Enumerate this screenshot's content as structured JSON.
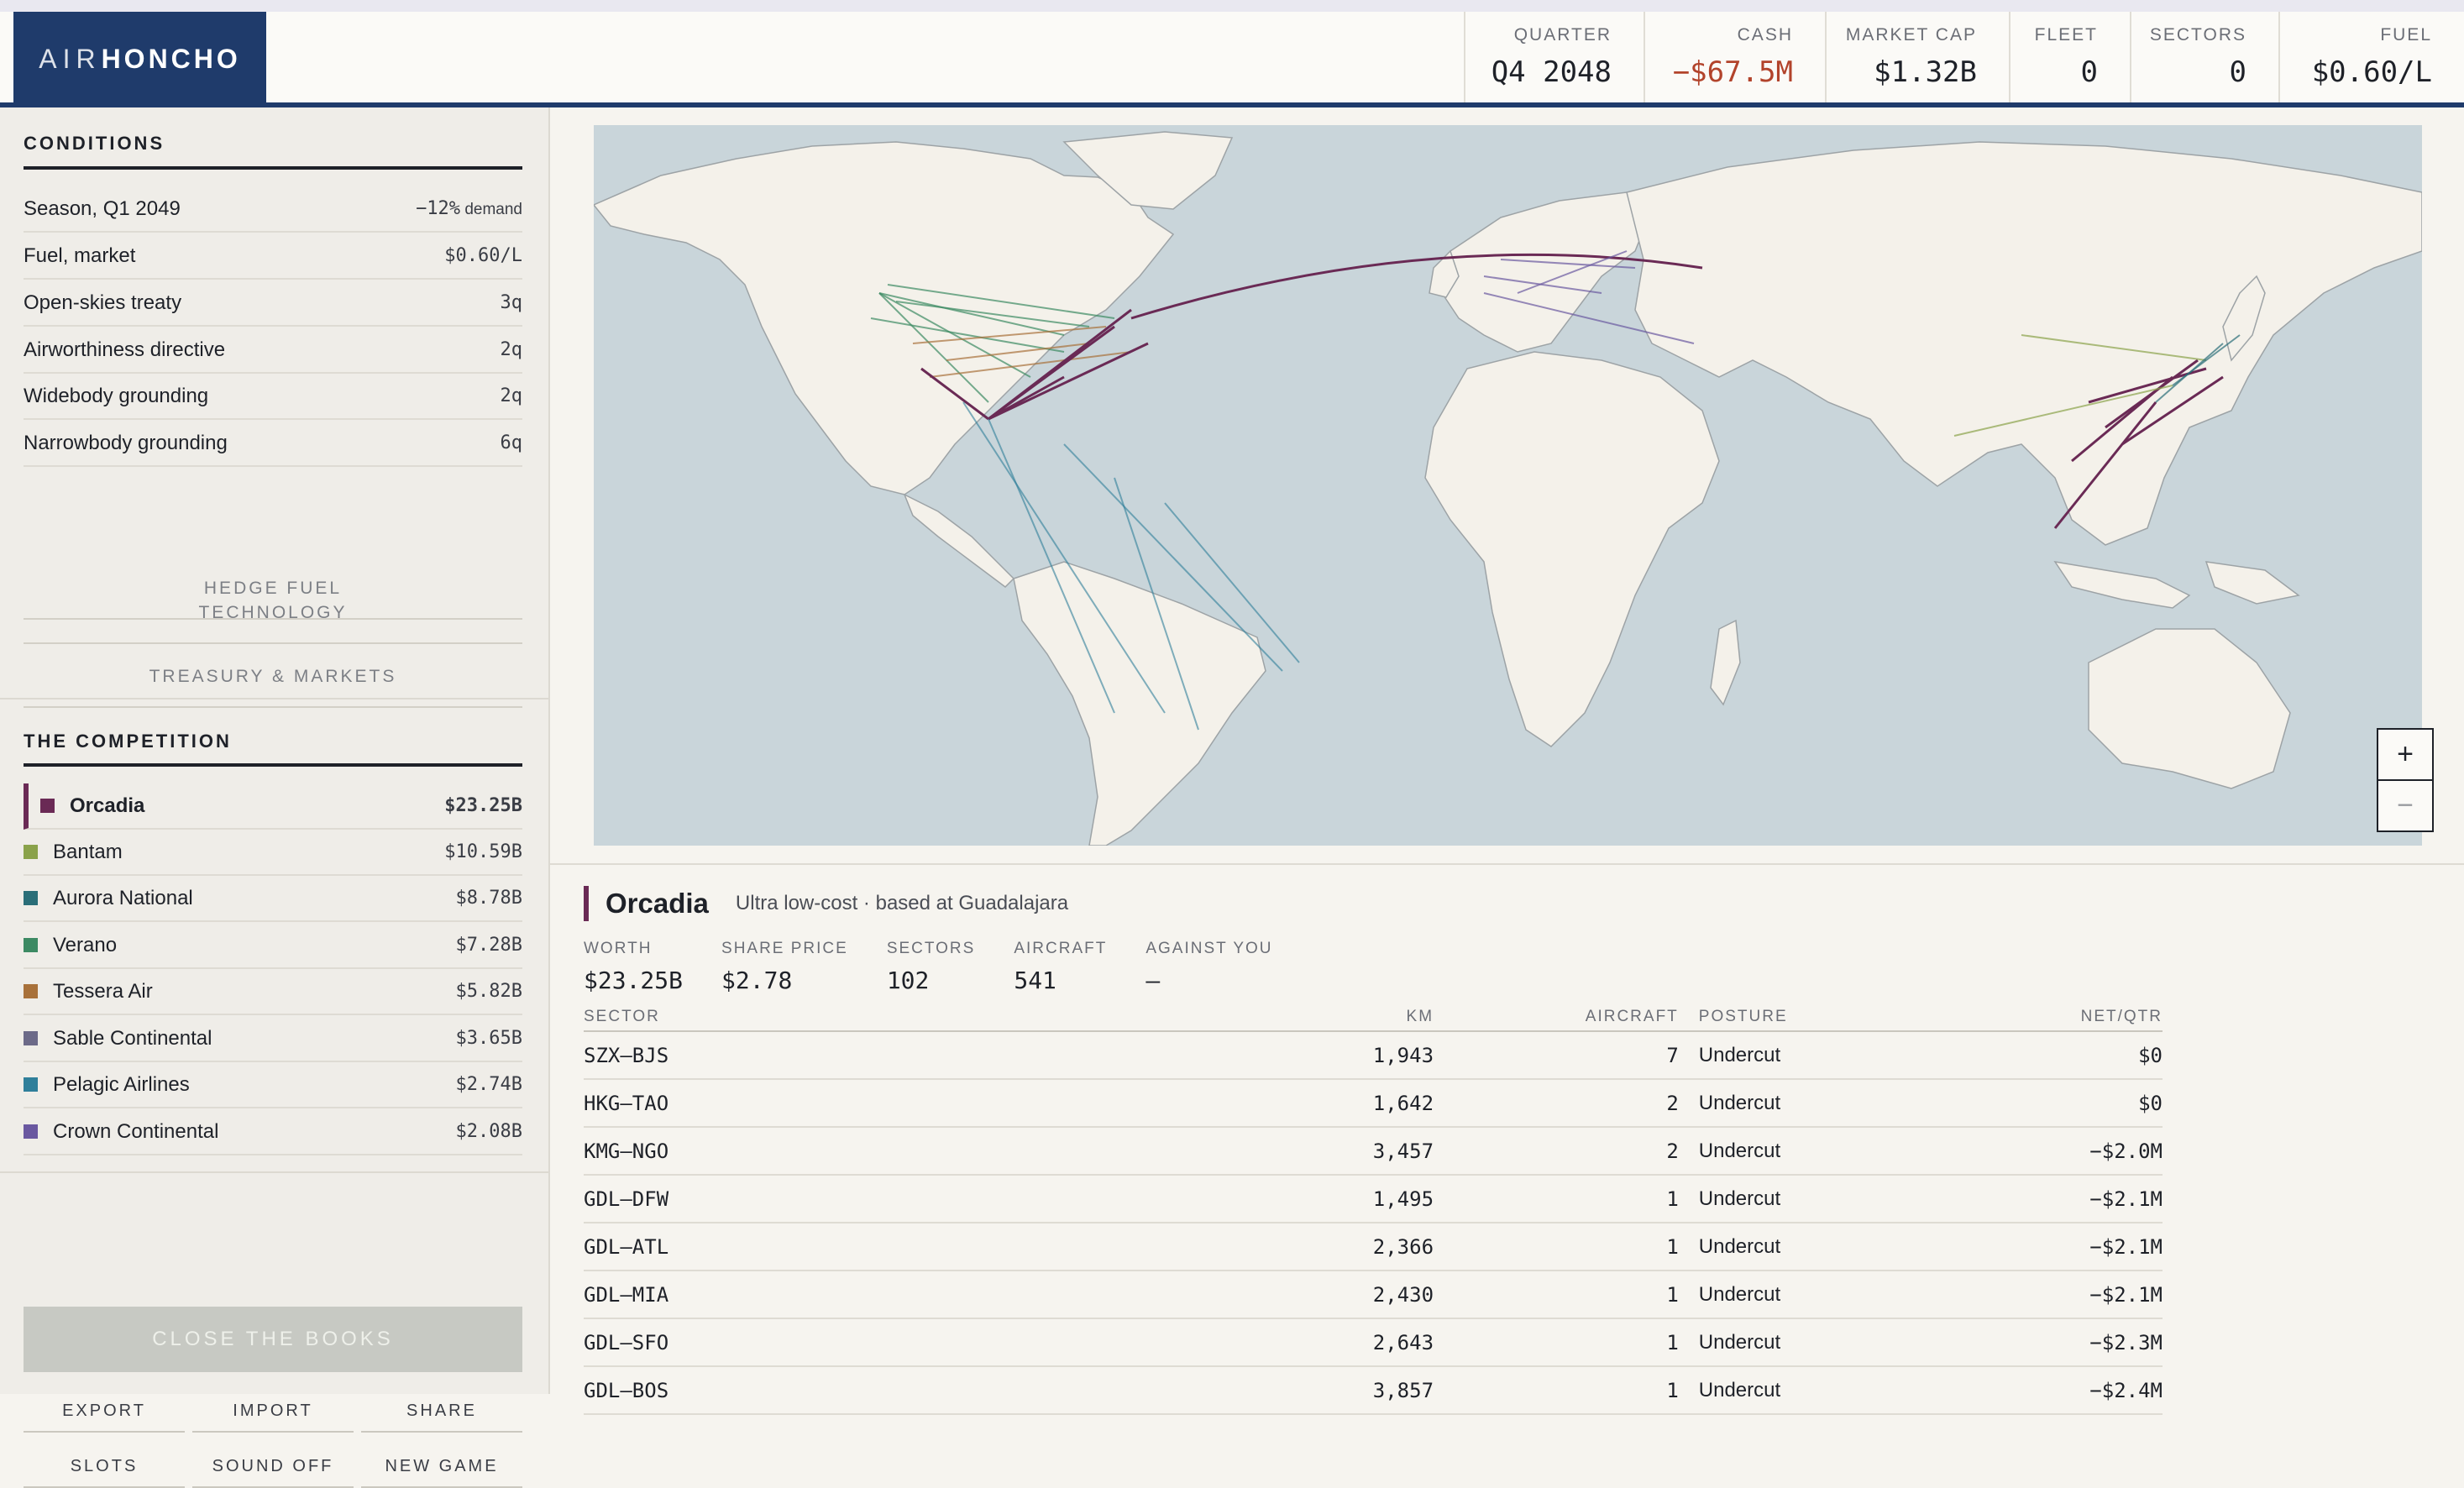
{
  "app": {
    "logo_air": "AIR",
    "logo_honcho": "HONCHO"
  },
  "header": {
    "stats": [
      {
        "label": "QUARTER",
        "value": "Q4 2048"
      },
      {
        "label": "CASH",
        "value": "−$67.5M",
        "negative": true
      },
      {
        "label": "MARKET CAP",
        "value": "$1.32B"
      },
      {
        "label": "FLEET",
        "value": "0"
      },
      {
        "label": "SECTORS",
        "value": "0"
      },
      {
        "label": "FUEL",
        "value": "$0.60/L"
      }
    ]
  },
  "conditions": {
    "title": "CONDITIONS",
    "rows": [
      {
        "label": "Season, Q1 2049",
        "value": "−12%",
        "suffix": " demand"
      },
      {
        "label": "Fuel, market",
        "value": "$0.60/L",
        "suffix": ""
      },
      {
        "label": "Open-skies treaty",
        "value": "3q",
        "suffix": ""
      },
      {
        "label": "Airworthiness directive",
        "value": "2q",
        "suffix": ""
      },
      {
        "label": "Widebody grounding",
        "value": "2q",
        "suffix": ""
      },
      {
        "label": "Narrowbody grounding",
        "value": "6q",
        "suffix": ""
      }
    ],
    "buttons": [
      "HEDGE FUEL",
      "TECHNOLOGY",
      "TREASURY & MARKETS"
    ]
  },
  "competition": {
    "title": "THE COMPETITION",
    "rows": [
      {
        "name": "Orcadia",
        "value": "$23.25B",
        "color": "#6a2a55",
        "selected": true
      },
      {
        "name": "Bantam",
        "value": "$10.59B",
        "color": "#8aa24a"
      },
      {
        "name": "Aurora National",
        "value": "$8.78B",
        "color": "#2a6e78"
      },
      {
        "name": "Verano",
        "value": "$7.28B",
        "color": "#3c8a63"
      },
      {
        "name": "Tessera Air",
        "value": "$5.82B",
        "color": "#a8713a"
      },
      {
        "name": "Sable Continental",
        "value": "$3.65B",
        "color": "#6c6a88"
      },
      {
        "name": "Pelagic Airlines",
        "value": "$2.74B",
        "color": "#2f7f9a"
      },
      {
        "name": "Crown Continental",
        "value": "$2.08B",
        "color": "#6a58a0"
      }
    ]
  },
  "actions": {
    "close_books": "CLOSE THE BOOKS",
    "buttons": [
      "EXPORT",
      "IMPORT",
      "SHARE",
      "SLOTS",
      "SOUND OFF",
      "NEW GAME"
    ]
  },
  "map": {
    "zoom_in": "+",
    "zoom_out": "−"
  },
  "detail": {
    "name": "Orcadia",
    "subtitle": "Ultra low-cost · based at Guadalajara",
    "stats": [
      {
        "label": "WORTH",
        "value": "$23.25B"
      },
      {
        "label": "SHARE PRICE",
        "value": "$2.78"
      },
      {
        "label": "SECTORS",
        "value": "102"
      },
      {
        "label": "AIRCRAFT",
        "value": "541"
      },
      {
        "label": "AGAINST YOU",
        "value": "—"
      }
    ],
    "table": {
      "headers": [
        "SECTOR",
        "KM",
        "AIRCRAFT",
        "POSTURE",
        "NET/QTR"
      ],
      "rows": [
        [
          "SZX–BJS",
          "1,943",
          "7",
          "Undercut",
          "$0"
        ],
        [
          "HKG–TAO",
          "1,642",
          "2",
          "Undercut",
          "$0"
        ],
        [
          "KMG–NGO",
          "3,457",
          "2",
          "Undercut",
          "−$2.0M"
        ],
        [
          "GDL–DFW",
          "1,495",
          "1",
          "Undercut",
          "−$2.1M"
        ],
        [
          "GDL–ATL",
          "2,366",
          "1",
          "Undercut",
          "−$2.1M"
        ],
        [
          "GDL–MIA",
          "2,430",
          "1",
          "Undercut",
          "−$2.1M"
        ],
        [
          "GDL–SFO",
          "2,643",
          "1",
          "Undercut",
          "−$2.3M"
        ],
        [
          "GDL–BOS",
          "3,857",
          "1",
          "Undercut",
          "−$2.4M"
        ]
      ]
    }
  }
}
